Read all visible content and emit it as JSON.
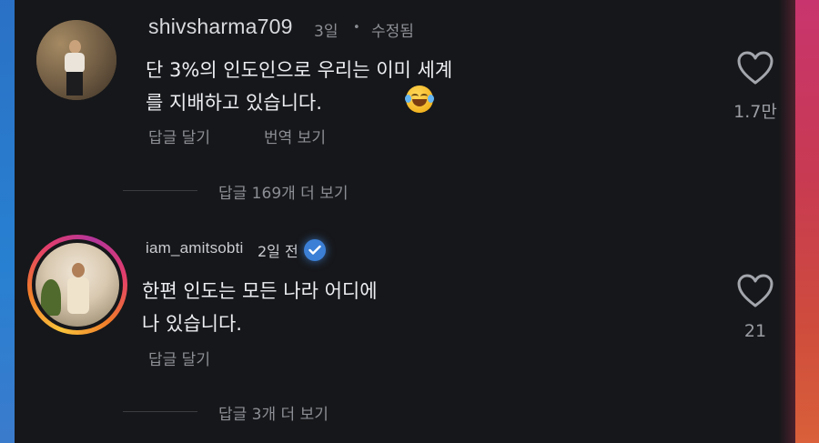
{
  "comments": [
    {
      "username": "shivsharma709",
      "time": "3일",
      "separator": "•",
      "edited": "수정됨",
      "body_line1": "단 3%의 인도인으로 우리는 이미 세계",
      "body_line2": "를 지배하고 있습니다.",
      "reply_label": "답글 달기",
      "translate_label": "번역 보기",
      "like_count": "1.7만",
      "more_replies": "답글 169개 더 보기"
    },
    {
      "username": "iam_amitsobti",
      "time": "2일 전",
      "verified": true,
      "body_line1": "한편 인도는 모든 나라 어디에",
      "body_line2": "나 있습니다.",
      "reply_label": "답글 달기",
      "like_count": "21",
      "more_replies": "답글 3개 더 보기"
    }
  ],
  "colors": {
    "background": "#16171a",
    "verified_badge": "#3b7fd6",
    "text_primary": "#eceef1",
    "text_secondary": "#8b8e94"
  },
  "icons": [
    "heart-icon",
    "verified-badge-icon",
    "laughing-emoji-icon"
  ]
}
